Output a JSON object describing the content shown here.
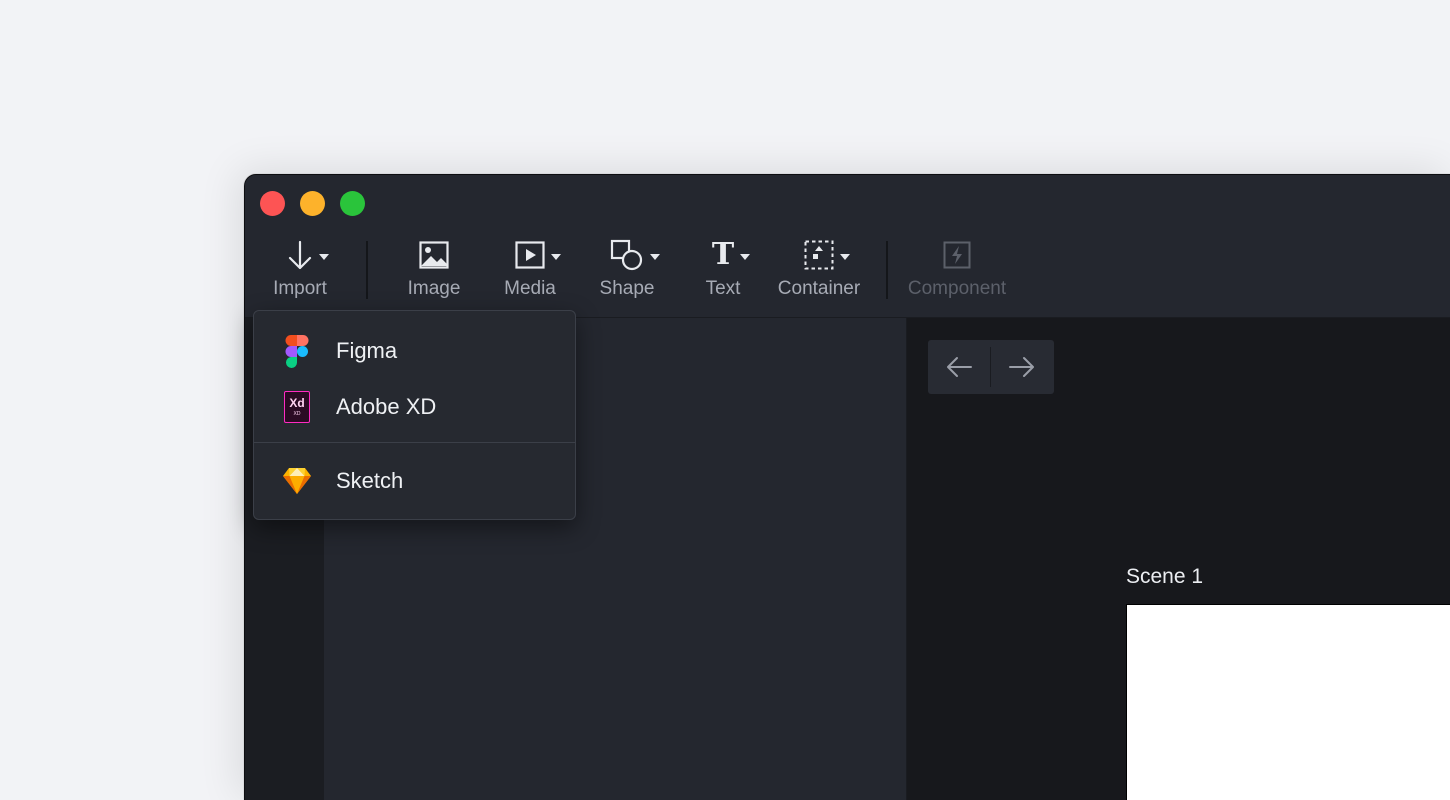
{
  "toolbar": {
    "import_label": "Import",
    "image_label": "Image",
    "media_label": "Media",
    "shape_label": "Shape",
    "text_label": "Text",
    "text_icon_glyph": "T",
    "container_label": "Container",
    "component_label": "Component"
  },
  "import_menu": {
    "items": [
      {
        "label": "Figma",
        "icon": "figma-icon"
      },
      {
        "label": "Adobe XD",
        "icon": "adobe-xd-icon"
      },
      {
        "label": "Sketch",
        "icon": "sketch-icon"
      }
    ],
    "xd_badge_text": "Xd",
    "xd_badge_sub": "XD"
  },
  "canvas": {
    "scene_label": "Scene 1"
  },
  "colors": {
    "window_bg": "#24272f",
    "canvas_bg": "#17181c",
    "traffic_close": "#fd5454",
    "traffic_minimize": "#fdb22b",
    "traffic_maximize": "#2ac43b",
    "xd_magenta": "#ff2bc2",
    "sketch_orange": "#fdb300"
  }
}
